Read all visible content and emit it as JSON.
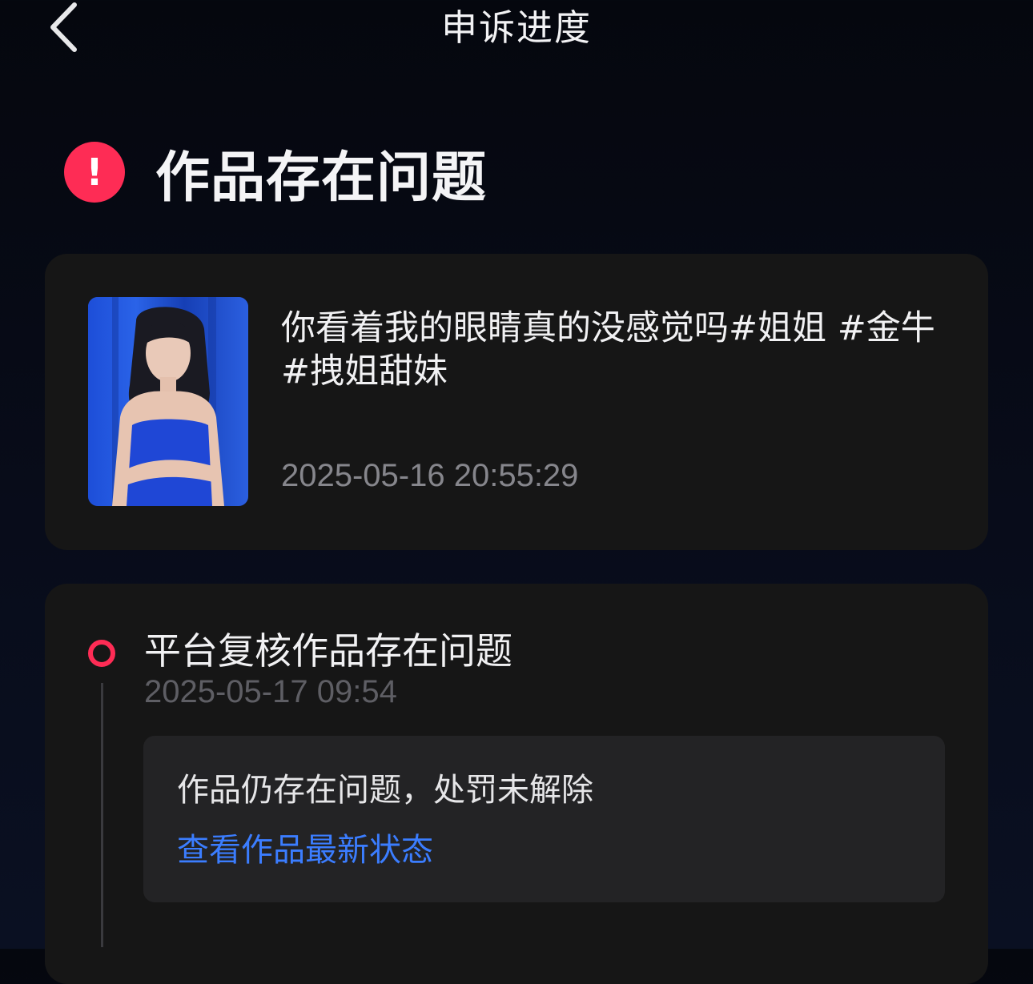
{
  "header": {
    "title": "申诉进度",
    "back_icon": "chevron-left-icon"
  },
  "status": {
    "icon": "exclamation-icon",
    "icon_color": "#fe2c55",
    "title": "作品存在问题"
  },
  "work": {
    "title": "你看着我的眼睛真的没感觉吗#姐姐 #金牛 #拽姐甜妹",
    "time": "2025-05-16 20:55:29"
  },
  "timeline": {
    "events": [
      {
        "title": "平台复核作品存在问题",
        "time": "2025-05-17 09:54",
        "detail": "作品仍存在问题，处罚未解除",
        "link_label": "查看作品最新状态",
        "link_color": "#3b7dff"
      }
    ]
  },
  "colors": {
    "accent": "#fe2c55",
    "card_bg": "#161616",
    "background": "#05070e"
  }
}
